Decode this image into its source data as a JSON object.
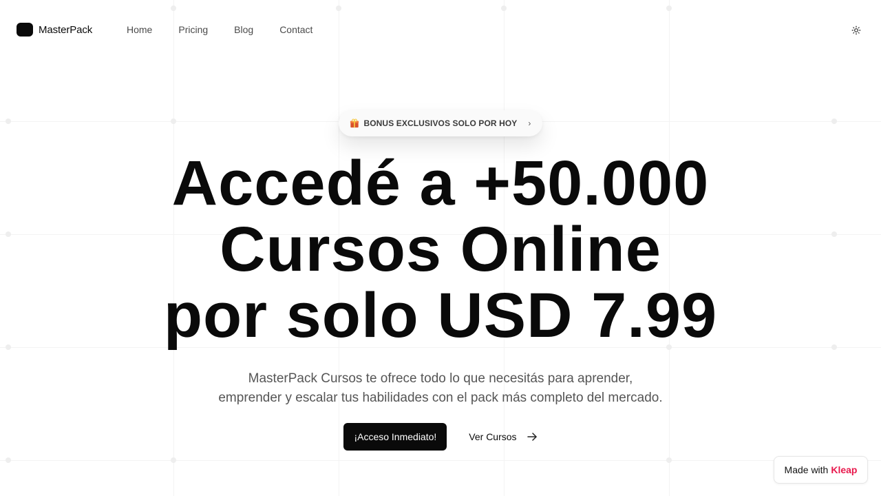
{
  "header": {
    "brand": "MasterPack",
    "nav": [
      {
        "label": "Home"
      },
      {
        "label": "Pricing"
      },
      {
        "label": "Blog"
      },
      {
        "label": "Contact"
      }
    ],
    "theme_toggle_icon": "sun-icon"
  },
  "badge": {
    "icon": "gift-icon",
    "label": "BONUS EXCLUSIVOS SOLO POR HOY",
    "chevron": "›"
  },
  "hero": {
    "title_lines": [
      "Accedé a +50.000",
      "Cursos Online",
      "por solo USD 7.99"
    ],
    "subtitle_lines": [
      "MasterPack Cursos te ofrece todo lo que necesitás para aprender,",
      "emprender y escalar tus habilidades con el pack más completo del mercado."
    ],
    "primary_cta": "¡Acceso Inmediato!",
    "secondary_cta": "Ver Cursos",
    "secondary_icon": "arrow-right-icon"
  },
  "footer_badge": {
    "prefix": "Made with",
    "brand": "Kleap",
    "brand_color": "#e8184c"
  }
}
